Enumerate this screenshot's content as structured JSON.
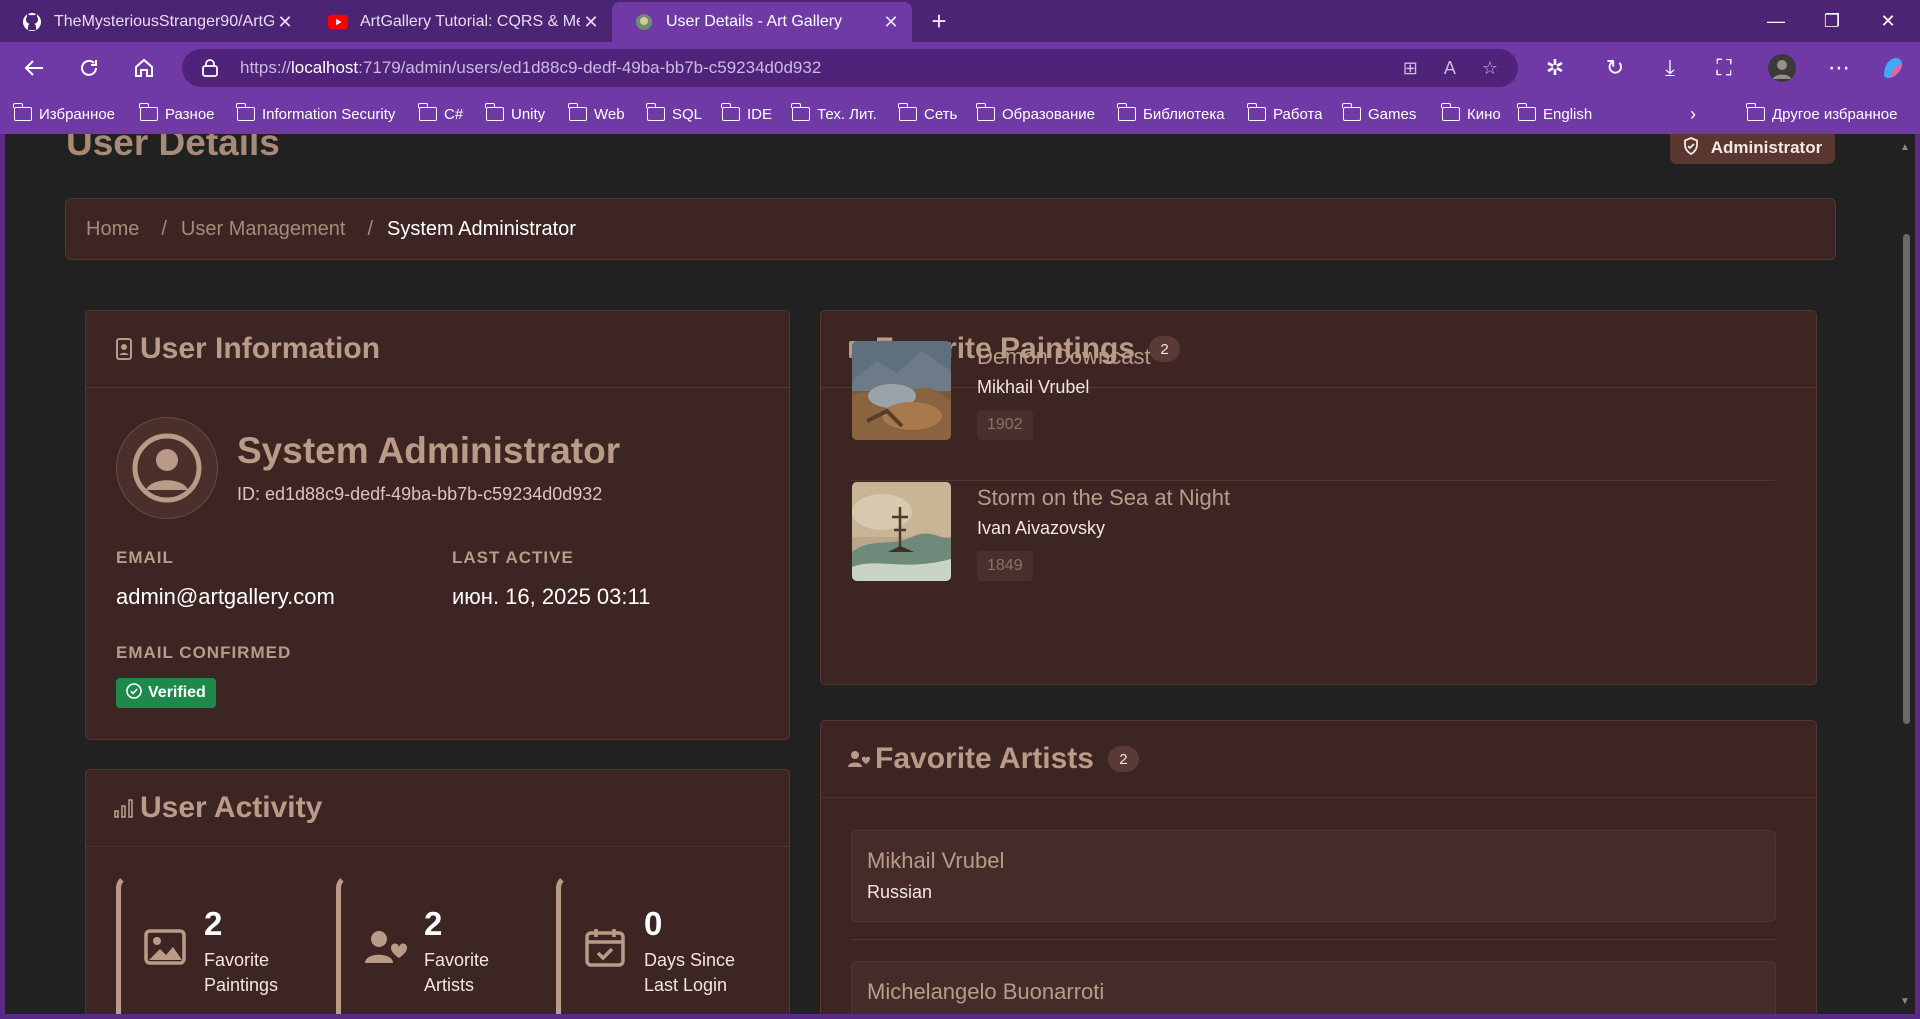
{
  "browser": {
    "tabs": [
      {
        "title": "TheMysteriousStranger90/ArtGall",
        "icon": "github-icon"
      },
      {
        "title": "ArtGallery Tutorial: CQRS & Medi",
        "icon": "youtube-icon"
      },
      {
        "title": "User Details - Art Gallery",
        "icon": "art-gallery-icon"
      }
    ],
    "url_prefix": "https://",
    "url_host": "localhost",
    "url_rest": ":7179/admin/users/ed1d88c9-dedf-49ba-bb7b-c59234d0d932",
    "bookmarks": [
      "Избранное",
      "Разное",
      "Information Security",
      "C#",
      "Unity",
      "Web",
      "SQL",
      "IDE",
      "Тех. Лит.",
      "Сеть",
      "Образование",
      "Библиотека",
      "Работа",
      "Games",
      "Кино",
      "English"
    ],
    "other_bookmarks": "Другое избранное"
  },
  "page": {
    "title": "User Details",
    "role_badge": "Administrator",
    "breadcrumb": {
      "home": "Home",
      "section": "User Management",
      "sep": "/",
      "current": "System Administrator"
    }
  },
  "user_info": {
    "heading": "User Information",
    "name": "System Administrator",
    "id_line": "ID: ed1d88c9-dedf-49ba-bb7b-c59234d0d932",
    "email_label": "EMAIL",
    "email": "admin@artgallery.com",
    "last_active_label": "LAST ACTIVE",
    "last_active": "июн. 16, 2025 03:11",
    "email_confirmed_label": "EMAIL CONFIRMED",
    "verified": "Verified"
  },
  "activity": {
    "heading": "User Activity",
    "stats": [
      {
        "value": "2",
        "label_1": "Favorite",
        "label_2": "Paintings",
        "icon": "image-icon"
      },
      {
        "value": "2",
        "label_1": "Favorite",
        "label_2": "Artists",
        "icon": "user-heart-icon"
      },
      {
        "value": "0",
        "label_1": "Days Since",
        "label_2": "Last Login",
        "icon": "calendar-check-icon"
      }
    ]
  },
  "paintings": {
    "heading": "Favorite Paintings",
    "count": "2",
    "items": [
      {
        "title": "Demon Downcast",
        "artist": "Mikhail Vrubel",
        "year": "1902"
      },
      {
        "title": "Storm on the Sea at Night",
        "artist": "Ivan Aivazovsky",
        "year": "1849"
      }
    ]
  },
  "artists": {
    "heading": "Favorite Artists",
    "count": "2",
    "items": [
      {
        "name": "Mikhail Vrubel",
        "nationality": "Russian"
      },
      {
        "name": "Michelangelo Buonarroti",
        "nationality": ""
      }
    ]
  },
  "colors": {
    "browser_accent": "#6f3aa6",
    "card_bg": "#3c2522",
    "heading": "#b99b88",
    "verified": "#1d8a4b"
  }
}
